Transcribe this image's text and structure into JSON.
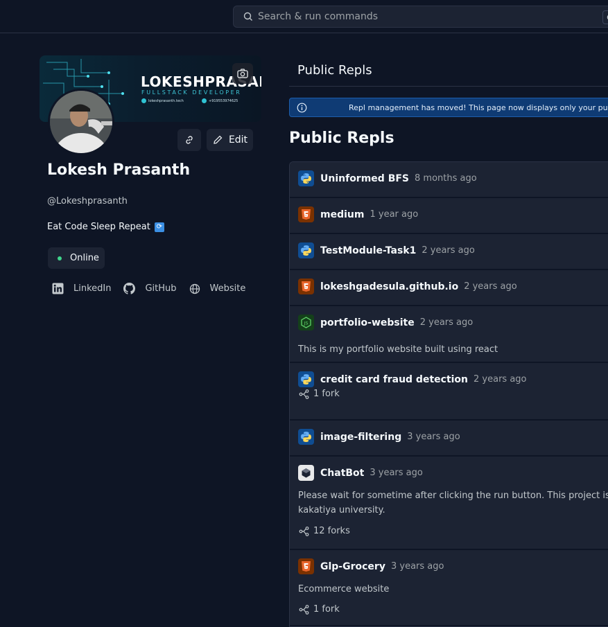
{
  "search": {
    "placeholder": "Search & run commands",
    "shortcut": "C"
  },
  "banner": {
    "title": "LOKESHPRASANTH",
    "subtitle": "FULLSTACK DEVELOPER",
    "website": "lokeshprasanth.tech",
    "phone": "+919553974625"
  },
  "profile": {
    "name": "Lokesh Prasanth",
    "handle": "@Lokeshprasanth",
    "bio": "Eat Code Sleep Repeat",
    "bio_emoji": "🔁",
    "status": "Online",
    "edit_label": "Edit",
    "social": [
      {
        "label": "LinkedIn",
        "icon": "linkedin-icon"
      },
      {
        "label": "GitHub",
        "icon": "github-icon"
      },
      {
        "label": "Website",
        "icon": "globe-icon"
      }
    ]
  },
  "main": {
    "tab_label": "Public Repls",
    "notice": "Repl management has moved! This page now displays only your public Repls.",
    "section_title": "Public Repls",
    "repls": [
      {
        "title": "Uninformed BFS",
        "time": "8 months ago",
        "lang": "python"
      },
      {
        "title": "medium",
        "time": "1 year ago",
        "lang": "html"
      },
      {
        "title": "TestModule-Task1",
        "time": "2 years ago",
        "lang": "python"
      },
      {
        "title": "lokeshgadesula.github.io",
        "time": "2 years ago",
        "lang": "html"
      },
      {
        "title": "portfolio-website",
        "time": "2 years ago",
        "lang": "nodejs",
        "description": "This is my portfolio website built using react"
      },
      {
        "title": "credit card fraud detection",
        "time": "2 years ago",
        "lang": "python",
        "forks": "1 fork"
      },
      {
        "title": "image-filtering",
        "time": "3 years ago",
        "lang": "python"
      },
      {
        "title": "ChatBot",
        "time": "3 years ago",
        "lang": "blank",
        "description": "Please wait for sometime after clicking the run button. This project is done",
        "description2": "kakatiya university.",
        "forks": "12 forks"
      },
      {
        "title": "Glp-Grocery",
        "time": "3 years ago",
        "lang": "html",
        "description": "Ecommerce website",
        "forks": "1 fork"
      }
    ]
  }
}
